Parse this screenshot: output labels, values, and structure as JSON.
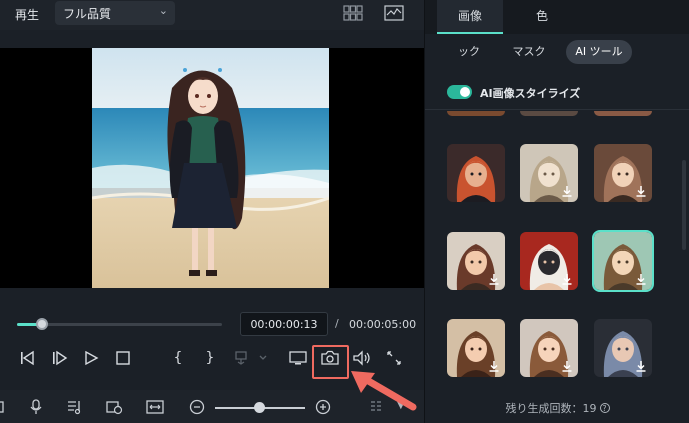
{
  "player": {
    "play_label": "再生",
    "quality": "フル品質",
    "current_time": "00:00:00:13",
    "separator": "/",
    "total_time": "00:00:05:00",
    "progress": 0.12
  },
  "right_panel": {
    "tabs": [
      {
        "label": "画像",
        "active": true
      },
      {
        "label": "色",
        "active": false
      }
    ],
    "subtabs": [
      {
        "label": "ック",
        "active": false
      },
      {
        "label": "マスク",
        "active": false
      },
      {
        "label": "AI ツール",
        "active": true
      }
    ],
    "stylize_toggle": {
      "label": "AI画像スタイライズ",
      "on": true
    },
    "remaining_prefix": "残り生成回数：",
    "remaining_count": "19",
    "help_glyph": "?"
  },
  "colors": {
    "accent": "#5be0c9",
    "highlight_red": "#ef6a60",
    "toggle_green": "#2bb79b"
  },
  "style_thumbnails": [
    {
      "name": "style-1",
      "download": false,
      "selected": false
    },
    {
      "name": "style-2",
      "download": true,
      "selected": false
    },
    {
      "name": "style-3",
      "download": true,
      "selected": false
    },
    {
      "name": "style-4",
      "download": true,
      "selected": false
    },
    {
      "name": "style-5",
      "download": true,
      "selected": false
    },
    {
      "name": "style-6",
      "download": true,
      "selected": true
    },
    {
      "name": "style-7",
      "download": true,
      "selected": false
    },
    {
      "name": "style-8",
      "download": true,
      "selected": false
    },
    {
      "name": "style-9",
      "download": true,
      "selected": false
    }
  ]
}
